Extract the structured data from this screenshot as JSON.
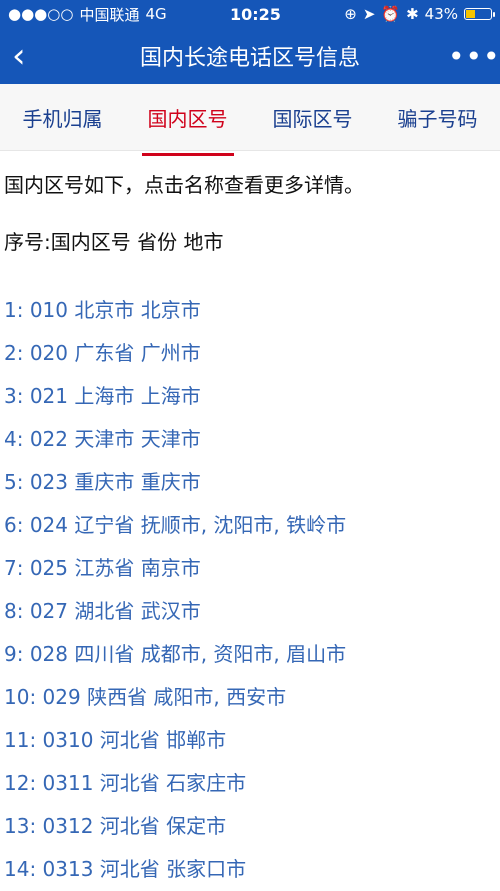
{
  "status_bar": {
    "signal": "●●●○○",
    "carrier": "中国联通",
    "network": "4G",
    "time": "10:25",
    "battery_percent": "43%",
    "battery_level": 0.43
  },
  "navbar": {
    "back_icon": "‹",
    "title": "国内长途电话区号信息",
    "more_icon": "•••"
  },
  "tabs": [
    {
      "label": "手机归属"
    },
    {
      "label": "国内区号"
    },
    {
      "label": "国际区号"
    },
    {
      "label": "骗子号码"
    }
  ],
  "content": {
    "intro": "国内区号如下，点击名称查看更多详情。",
    "legend": "序号:国内区号 省份 地市",
    "items": [
      "1: 010 北京市 北京市",
      "2: 020 广东省 广州市",
      "3: 021 上海市 上海市",
      "4: 022 天津市 天津市",
      "5: 023 重庆市 重庆市",
      "6: 024 辽宁省 抚顺市, 沈阳市, 铁岭市",
      "7: 025 江苏省 南京市",
      "8: 027 湖北省 武汉市",
      "9: 028 四川省 成都市, 资阳市, 眉山市",
      "10: 029 陕西省 咸阳市, 西安市",
      "11: 0310 河北省 邯郸市",
      "12: 0311 河北省 石家庄市",
      "13: 0312 河北省 保定市",
      "14: 0313 河北省 张家口市"
    ]
  },
  "colors": {
    "primary": "#1556b8",
    "active_tab": "#d0021b",
    "link": "#3567b5"
  }
}
